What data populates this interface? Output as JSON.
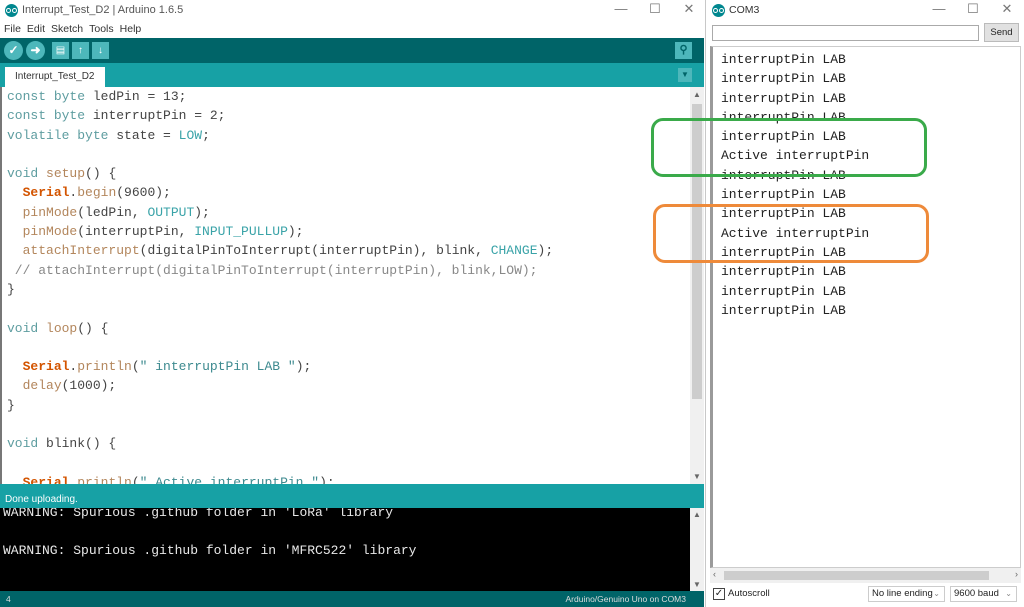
{
  "ide": {
    "window_title": "Interrupt_Test_D2 | Arduino 1.6.5",
    "window_controls": {
      "minimize": "—",
      "maximize": "☐",
      "close": "✕"
    },
    "menu": [
      "File",
      "Edit",
      "Sketch",
      "Tools",
      "Help"
    ],
    "toolbar": {
      "verify": "✓",
      "upload": "➜",
      "new": "▤",
      "open": "↑",
      "save": "↓",
      "serial_monitor": "⚲"
    },
    "tab": {
      "label": "Interrupt_Test_D2",
      "menu_glyph": "▼"
    },
    "code": [
      "const byte ledPin = 13;",
      "const byte interruptPin = 2;",
      "volatile byte state = LOW;",
      "",
      "void setup() {",
      "  Serial.begin(9600);",
      "  pinMode(ledPin, OUTPUT);",
      "  pinMode(interruptPin, INPUT_PULLUP);",
      "  attachInterrupt(digitalPinToInterrupt(interruptPin), blink, CHANGE);",
      " // attachInterrupt(digitalPinToInterrupt(interruptPin), blink,LOW);",
      "}",
      "",
      "void loop() {",
      "",
      "  Serial.println(\" interruptPin LAB \");",
      "  delay(1000);",
      "}",
      "",
      "void blink() {",
      "",
      "  Serial.println(\" Active interruptPin \");"
    ],
    "status": "Done uploading.",
    "console": [
      "WARNING: Spurious .github folder in 'LoRa' library",
      "",
      "WARNING: Spurious .github folder in 'MFRC522' library"
    ],
    "line_number": "4",
    "board": "Arduino/Genuino Uno on COM3"
  },
  "serial_monitor": {
    "title": "COM3",
    "window_controls": {
      "minimize": "—",
      "maximize": "☐",
      "close": "✕"
    },
    "input_value": "",
    "send_label": "Send",
    "output": [
      "interruptPin LAB",
      "interruptPin LAB",
      "interruptPin LAB",
      "interruptPin LAB",
      "interruptPin LAB",
      "Active interruptPin",
      "interruptPin LAB",
      "interruptPin LAB",
      "interruptPin LAB",
      "Active interruptPin",
      "interruptPin LAB",
      "interruptPin LAB",
      "interruptPin LAB",
      "interruptPin LAB"
    ],
    "autoscroll_label": "Autoscroll",
    "autoscroll_checked": true,
    "line_ending": "No line ending",
    "baud": "9600 baud"
  },
  "annotations": {
    "green_color": "#3aaa4a",
    "orange_color": "#ee8a3a"
  }
}
